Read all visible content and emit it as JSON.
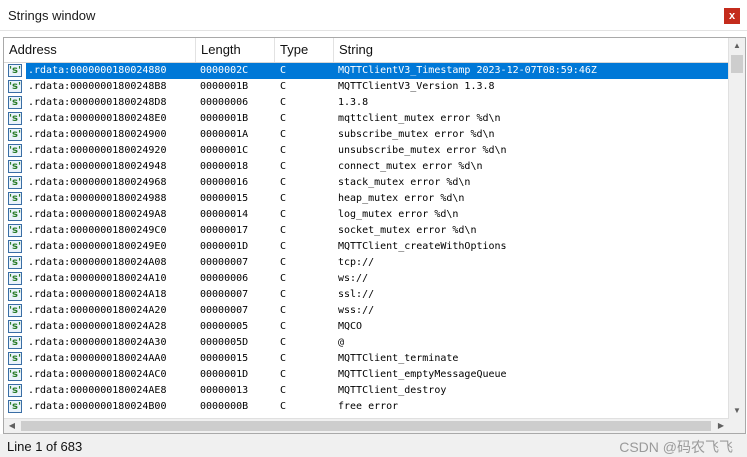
{
  "window": {
    "title": "Strings window",
    "close_glyph": "x"
  },
  "columns": [
    {
      "label": "Address"
    },
    {
      "label": "Length"
    },
    {
      "label": "Type"
    },
    {
      "label": "String"
    }
  ],
  "icon_glyph": "'s'",
  "rows": [
    {
      "address": ".rdata:0000000180024880",
      "length": "0000002C",
      "type": "C",
      "string": "MQTTClientV3_Timestamp 2023-12-07T08:59:46Z",
      "selected": true
    },
    {
      "address": ".rdata:00000001800248B8",
      "length": "0000001B",
      "type": "C",
      "string": "MQTTClientV3_Version 1.3.8"
    },
    {
      "address": ".rdata:00000001800248D8",
      "length": "00000006",
      "type": "C",
      "string": "1.3.8"
    },
    {
      "address": ".rdata:00000001800248E0",
      "length": "0000001B",
      "type": "C",
      "string": "mqttclient_mutex error %d\\n"
    },
    {
      "address": ".rdata:0000000180024900",
      "length": "0000001A",
      "type": "C",
      "string": "subscribe_mutex error %d\\n"
    },
    {
      "address": ".rdata:0000000180024920",
      "length": "0000001C",
      "type": "C",
      "string": "unsubscribe_mutex error %d\\n"
    },
    {
      "address": ".rdata:0000000180024948",
      "length": "00000018",
      "type": "C",
      "string": "connect_mutex error %d\\n"
    },
    {
      "address": ".rdata:0000000180024968",
      "length": "00000016",
      "type": "C",
      "string": "stack_mutex error %d\\n"
    },
    {
      "address": ".rdata:0000000180024988",
      "length": "00000015",
      "type": "C",
      "string": "heap_mutex error %d\\n"
    },
    {
      "address": ".rdata:00000001800249A8",
      "length": "00000014",
      "type": "C",
      "string": "log_mutex error %d\\n"
    },
    {
      "address": ".rdata:00000001800249C0",
      "length": "00000017",
      "type": "C",
      "string": "socket_mutex error %d\\n"
    },
    {
      "address": ".rdata:00000001800249E0",
      "length": "0000001D",
      "type": "C",
      "string": "MQTTClient_createWithOptions"
    },
    {
      "address": ".rdata:0000000180024A08",
      "length": "00000007",
      "type": "C",
      "string": "tcp://"
    },
    {
      "address": ".rdata:0000000180024A10",
      "length": "00000006",
      "type": "C",
      "string": "ws://"
    },
    {
      "address": ".rdata:0000000180024A18",
      "length": "00000007",
      "type": "C",
      "string": "ssl://"
    },
    {
      "address": ".rdata:0000000180024A20",
      "length": "00000007",
      "type": "C",
      "string": "wss://"
    },
    {
      "address": ".rdata:0000000180024A28",
      "length": "00000005",
      "type": "C",
      "string": "MQCO"
    },
    {
      "address": ".rdata:0000000180024A30",
      "length": "0000005D",
      "type": "C",
      "string": "@"
    },
    {
      "address": ".rdata:0000000180024AA0",
      "length": "00000015",
      "type": "C",
      "string": "MQTTClient_terminate"
    },
    {
      "address": ".rdata:0000000180024AC0",
      "length": "0000001D",
      "type": "C",
      "string": "MQTTClient_emptyMessageQueue"
    },
    {
      "address": ".rdata:0000000180024AE8",
      "length": "00000013",
      "type": "C",
      "string": "MQTTClient_destroy"
    },
    {
      "address": ".rdata:0000000180024B00",
      "length": "0000000B",
      "type": "C",
      "string": "free error"
    }
  ],
  "status": {
    "text": "Line 1 of 683",
    "watermark": "CSDN @码农飞飞"
  },
  "colors": {
    "selection": "#0078d7",
    "close_button": "#c42b1c",
    "status_bar": "#f0f0f0"
  }
}
